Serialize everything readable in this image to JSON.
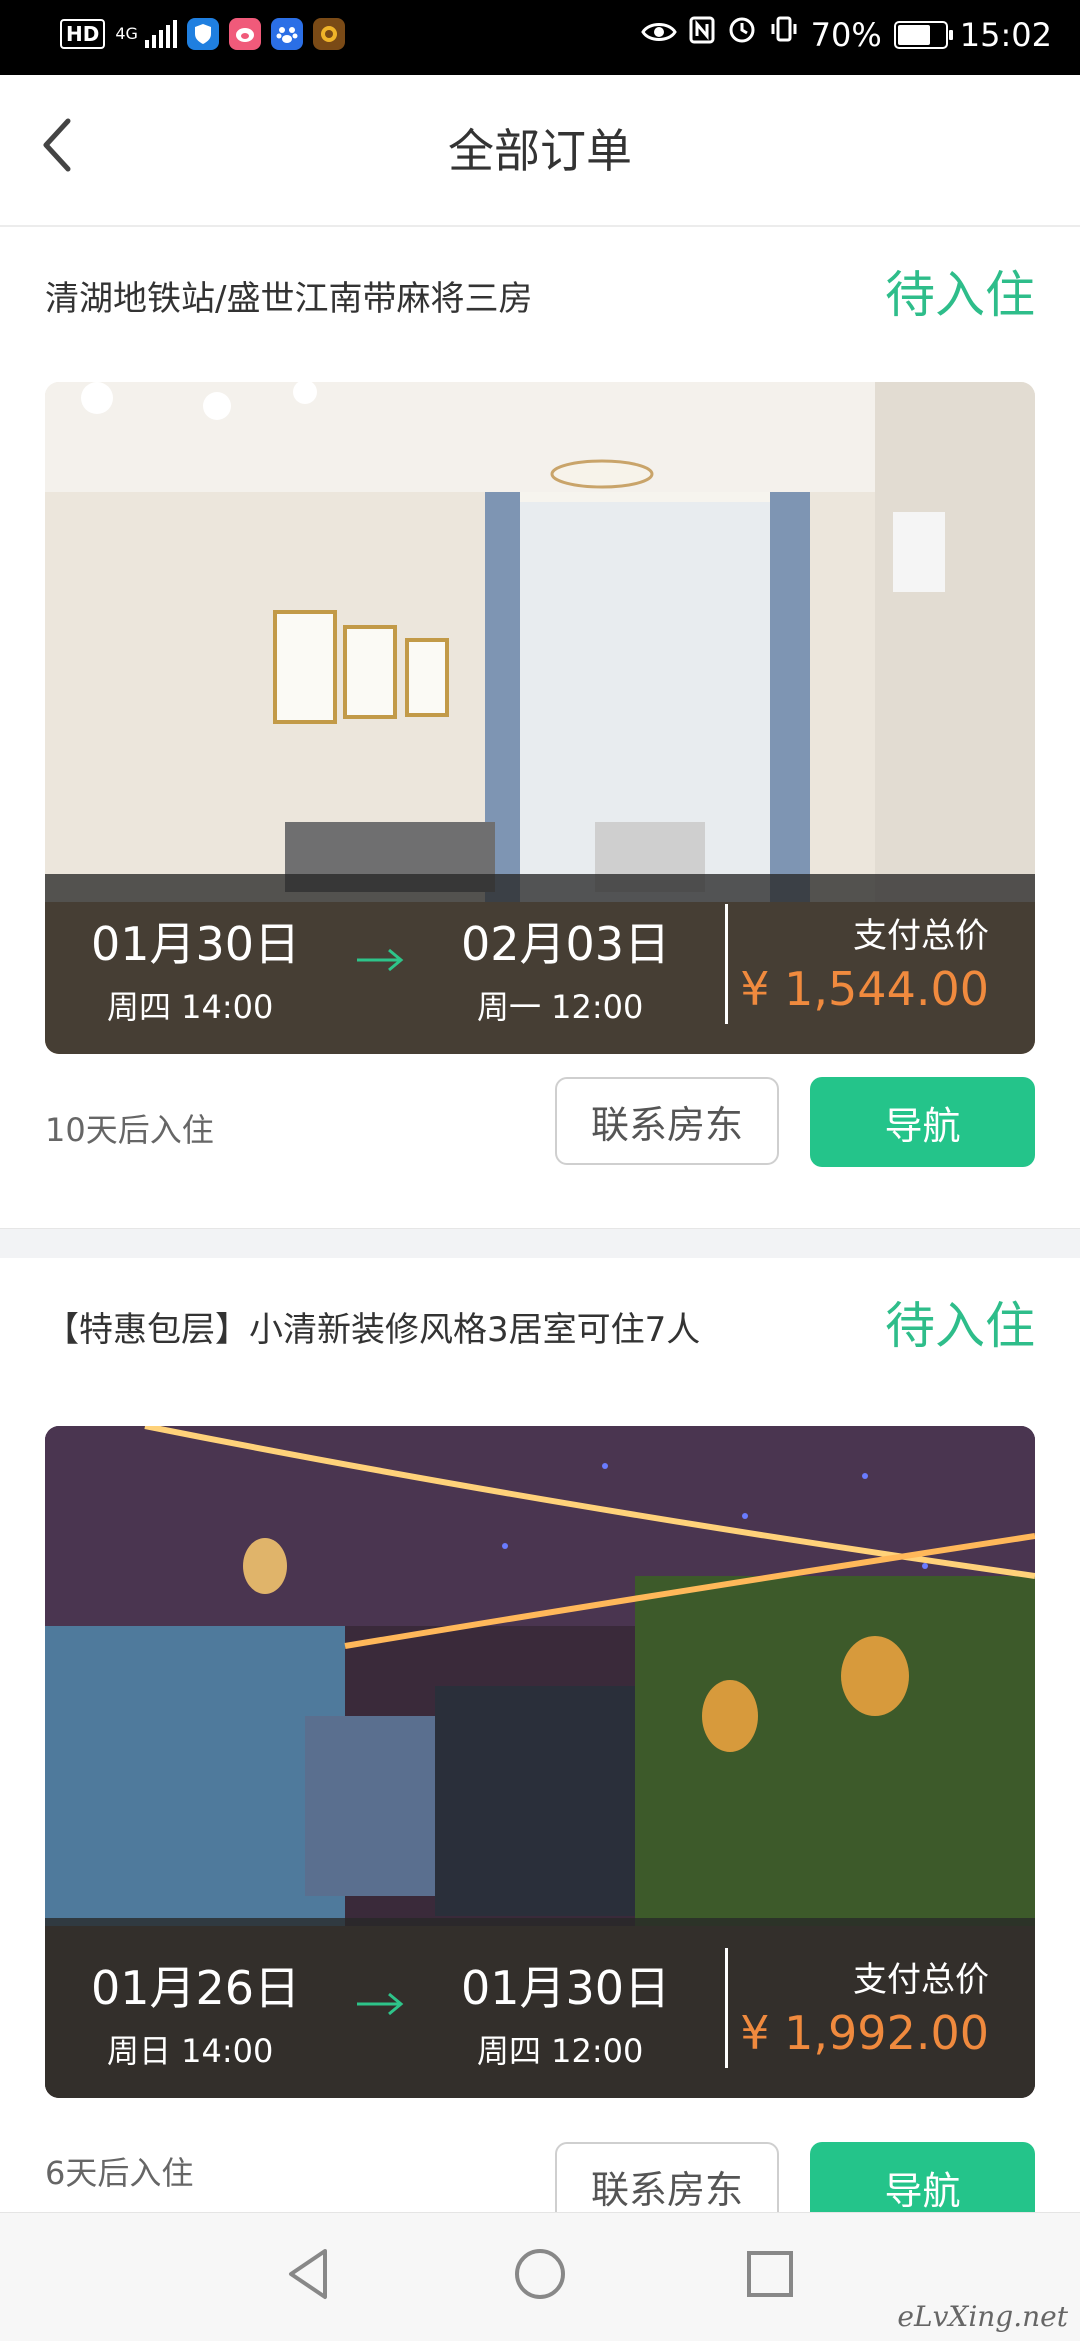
{
  "status_bar": {
    "hd": "HD",
    "network": "4G",
    "battery": "70%",
    "time": "15:02",
    "battery_level": 0.7,
    "icons": [
      "hd-icon",
      "signal-icon",
      "shield-app-icon",
      "pig-app-icon",
      "paw-app-icon",
      "game-app-icon",
      "eye-comfort-icon",
      "nfc-icon",
      "alarm-icon",
      "vibrate-icon",
      "battery-icon"
    ]
  },
  "header": {
    "title": "全部订单"
  },
  "orders": [
    {
      "name": "清湖地铁站/盛世江南带麻将三房",
      "status": "待入住",
      "checkin_date": "01月30日",
      "checkin_time": "周四 14:00",
      "checkout_date": "02月03日",
      "checkout_time": "周一 12:00",
      "price_label": "支付总价",
      "price": "¥ 1,544.00",
      "days_hint": "10天后入住",
      "contact_label": "联系房东",
      "nav_label": "导航"
    },
    {
      "name": "【特惠包层】小清新装修风格3居室可住7人",
      "status": "待入住",
      "checkin_date": "01月26日",
      "checkin_time": "周日 14:00",
      "checkout_date": "01月30日",
      "checkout_time": "周四 12:00",
      "price_label": "支付总价",
      "price": "¥ 1,992.00",
      "days_hint": "6天后入住",
      "contact_label": "联系房东",
      "nav_label": "导航"
    }
  ],
  "watermark": "eLvXing.net",
  "colors": {
    "accent_green": "#24c48a",
    "status_green": "#2ebd8a",
    "price_orange": "#f08a3e"
  }
}
